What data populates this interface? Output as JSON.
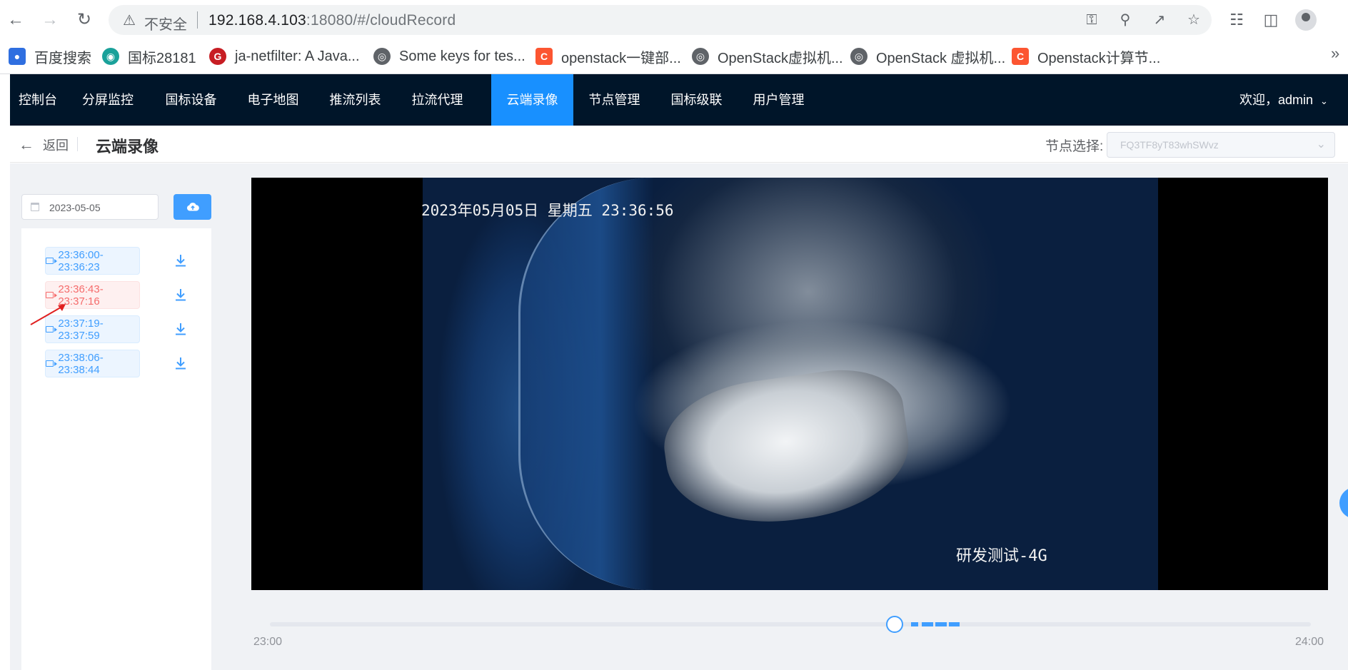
{
  "browser": {
    "insecure_label": "不安全",
    "url_host": "192.168.4.103",
    "url_rest": ":18080/#/cloudRecord",
    "bookmarks": [
      {
        "label": "百度搜索",
        "icon": "paw-icon",
        "color": "#2f6fe0"
      },
      {
        "label": "国标28181",
        "icon": "eye-icon",
        "color": "#1aa19a"
      },
      {
        "label": "ja-netfilter: A Java...",
        "icon": "gitee-icon",
        "color": "#c71d23"
      },
      {
        "label": "Some keys for tes...",
        "icon": "globe-icon",
        "color": "#5f6368"
      },
      {
        "label": "openstack一键部...",
        "icon": "csdn-icon",
        "color": "#fc5531"
      },
      {
        "label": "OpenStack虚拟机...",
        "icon": "globe-icon",
        "color": "#5f6368"
      },
      {
        "label": "OpenStack 虚拟机...",
        "icon": "globe-icon",
        "color": "#5f6368"
      },
      {
        "label": "Openstack计算节...",
        "icon": "csdn-icon",
        "color": "#fc5531"
      }
    ]
  },
  "nav": {
    "items": [
      "控制台",
      "分屏监控",
      "国标设备",
      "电子地图",
      "推流列表",
      "拉流代理",
      "云端录像",
      "节点管理",
      "国标级联",
      "用户管理"
    ],
    "active_index": 6,
    "welcome": "欢迎，admin"
  },
  "page": {
    "back_label": "返回",
    "title": "云端录像",
    "node_label": "节点选择:",
    "node_value": "FQ3TF8yT83whSWvz"
  },
  "sidebar": {
    "date": "2023-05-05",
    "records": [
      {
        "label": "23:36:00-23:36:23",
        "state": "normal"
      },
      {
        "label": "23:36:43-23:37:16",
        "state": "error"
      },
      {
        "label": "23:37:19-23:37:59",
        "state": "normal"
      },
      {
        "label": "23:38:06-23:38:44",
        "state": "normal"
      }
    ]
  },
  "video": {
    "osd_time": "2023年05月05日 星期五 23:36:56",
    "osd_name": "研发测试-4G"
  },
  "timeline": {
    "start_label": "23:00",
    "end_label": "24:00",
    "position_fraction": 0.6
  },
  "colors": {
    "primary": "#409eff",
    "active_nav": "#1890ff",
    "nav_bg": "#001529",
    "error": "#f56c6c"
  }
}
